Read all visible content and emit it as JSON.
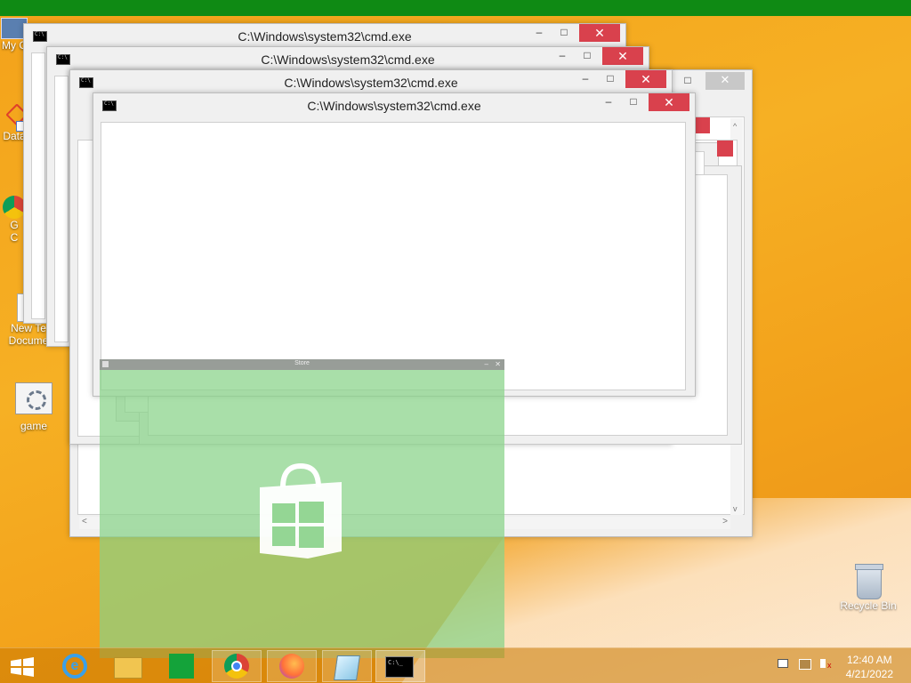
{
  "desktop": {
    "icons": [
      {
        "label": "My C"
      },
      {
        "label": "Data"
      },
      {
        "label": "G"
      },
      {
        "label": "C"
      },
      {
        "label": "New Te"
      },
      {
        "label": "Docume"
      },
      {
        "label": "game"
      },
      {
        "label": "Recycle Bin"
      }
    ]
  },
  "windows": [
    {
      "title": "C:\\Windows\\system32\\cmd.exe"
    },
    {
      "title": "C:\\Windows\\system32\\cmd.exe"
    },
    {
      "title": "C:\\Windows\\system32\\cmd.exe"
    },
    {
      "title": "C:\\Windows\\system32\\cmd.exe"
    }
  ],
  "window_controls": {
    "minimize": "–",
    "maximize": "□",
    "close": "✕"
  },
  "store": {
    "title": "Store",
    "minimize": "–",
    "close": "✕"
  },
  "taskbar": {
    "items": [
      "start-icon",
      "internet-explorer-icon",
      "file-explorer-icon",
      "store-icon",
      "chrome-icon",
      "firefox-icon",
      "notepad-icon",
      "cmd-icon"
    ],
    "time": "12:40 AM",
    "date": "4/21/2022"
  },
  "colors": {
    "close": "#d9414d",
    "green_bar": "#0f8a14",
    "store_tint": "#88d288"
  }
}
